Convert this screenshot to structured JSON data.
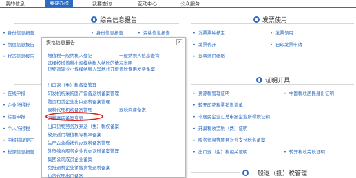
{
  "nav": {
    "items": [
      "我的信息",
      "我要办税",
      "我要查询",
      "互动中心",
      "公众服务"
    ]
  },
  "sections": {
    "report": "综合信息报告",
    "invoice": "发票使用",
    "cert": "证明开具",
    "tax": "一般退（抵）税管理"
  },
  "links": {
    "report": [
      "身份信息报告",
      "资格信息报告"
    ],
    "invoice": [
      "发票票种核定",
      "发票领用",
      "发票代开",
      "自印发票申请",
      "发票验旧缴销"
    ],
    "cert": [
      "资源税管理证明",
      "中国税收居民身份证明",
      "转开印花税票销售清单",
      "非居民企业汇总申报企业所得税证明",
      "开具税收完税（费）证明",
      "服务贸易等项目对外支付税务备案",
      "出口退（免）税相关证明",
      "转开税收完税证明"
    ],
    "left": [
      "身份信息报告",
      "制度信息报告",
      "状态信息报告",
      "在线申报",
      "企业所得税",
      "综合申报",
      "个人所得税",
      "申报错误更正",
      "税源信息报告"
    ]
  },
  "popup": {
    "title": "资格信息报告",
    "close": "×",
    "items": [
      "增值税一般纳税人登记",
      "一般纳税人信息查询",
      "选择按增值税小规模纳税人纳税的情况说明",
      "货物运输业小规模纳税人异地代开增值税专用发票备案",
      "出口退（免）税备案管理",
      "研发机构采购国产设备退税备案管理",
      "融资租赁企业出口退税备案管理",
      "退税代理机构备案管理",
      "退税商店备案",
      "退税商店备案变更",
      "出口货物劳务放弃退（免）税权备案",
      "放弃适用增值税零税率备案",
      "生产企业委托代办退税备案管理",
      "外贸综合服务企业代办退税备案管理",
      "集团公司成员企业备案",
      "免抵退税企业销售货物退税备案",
      "边贸代理出口备案"
    ]
  }
}
